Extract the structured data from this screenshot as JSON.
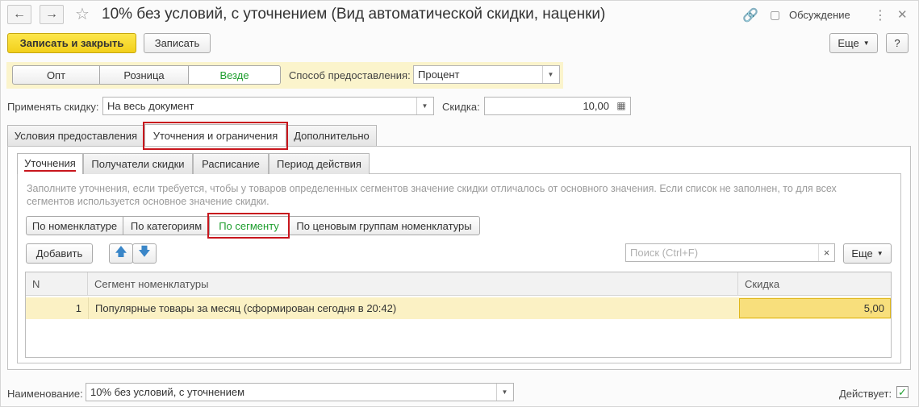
{
  "window": {
    "title": "10% без условий, с уточнением (Вид автоматической скидки, наценки)",
    "discussion_label": "Обсуждение",
    "back_glyph": "←",
    "forward_glyph": "→",
    "star_glyph": "☆",
    "link_glyph": "🔗",
    "more_glyph": "⋮",
    "close_glyph": "✕"
  },
  "toolbar": {
    "save_close_label": "Записать и закрыть",
    "save_label": "Записать",
    "more_label": "Еще",
    "help_label": "?"
  },
  "mode_segments": [
    "Опт",
    "Розница",
    "Везде"
  ],
  "method": {
    "label": "Способ предоставления:",
    "value": "Процент"
  },
  "apply": {
    "label": "Применять скидку:",
    "value": "На весь документ"
  },
  "discount": {
    "label": "Скидка:",
    "value": "10,00"
  },
  "tabs": [
    "Условия предоставления",
    "Уточнения и ограничения",
    "Дополнительно"
  ],
  "subtabs": [
    "Уточнения",
    "Получатели скидки",
    "Расписание",
    "Период действия"
  ],
  "info_text": "Заполните уточнения, если требуется, чтобы у товаров определенных сегментов значение скидки отличалось от основного значения. Если список не заполнен, то для всех сегментов используется основное значение скидки.",
  "filter_buttons": [
    "По номенклатуре",
    "По категориям",
    "По сегменту",
    "По ценовым группам номенклатуры"
  ],
  "list_toolbar": {
    "add_label": "Добавить",
    "up_glyph": "🡅",
    "down_glyph": "🡇",
    "search_placeholder": "Поиск (Ctrl+F)",
    "clear_glyph": "×",
    "more_label": "Еще"
  },
  "table": {
    "columns": [
      "N",
      "Сегмент номенклатуры",
      "Скидка"
    ],
    "rows": [
      {
        "n": "1",
        "segment": "Популярные товары за месяц (сформирован сегодня в 20:42)",
        "discount": "5,00"
      }
    ]
  },
  "footer": {
    "name_label": "Наименование:",
    "name_value": "10% без условий, с уточнением",
    "active_label": "Действует:",
    "active_checked": true
  },
  "colors": {
    "accent_green": "#1e9e2e",
    "highlight_red": "#c8161d",
    "primary_yellow": "#f5d52a"
  }
}
